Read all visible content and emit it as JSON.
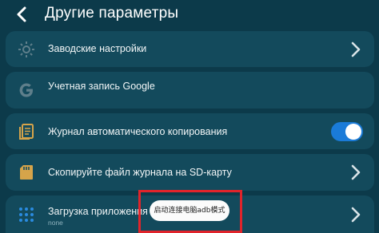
{
  "header": {
    "title": "Другие параметры"
  },
  "rows": [
    {
      "label": "Заводские настройки",
      "icon": "gear-icon"
    },
    {
      "label": "Учетная запись Google",
      "icon": "google-icon"
    },
    {
      "label": "Журнал автоматического копирования",
      "icon": "document-icon",
      "toggle_state": "on"
    },
    {
      "label": "Скопируйте файл журнала на SD-карту",
      "icon": "sd-card-icon"
    },
    {
      "label": "Загрузка приложения",
      "sublabel": "none",
      "icon": "apps-grid-icon"
    }
  ],
  "toast": {
    "text": "启动连接电脑adb模式"
  },
  "colors": {
    "background": "#0c3a4a",
    "row": "#134a5c",
    "toggle_on": "#1a7bd8",
    "highlight": "#e0242b"
  }
}
